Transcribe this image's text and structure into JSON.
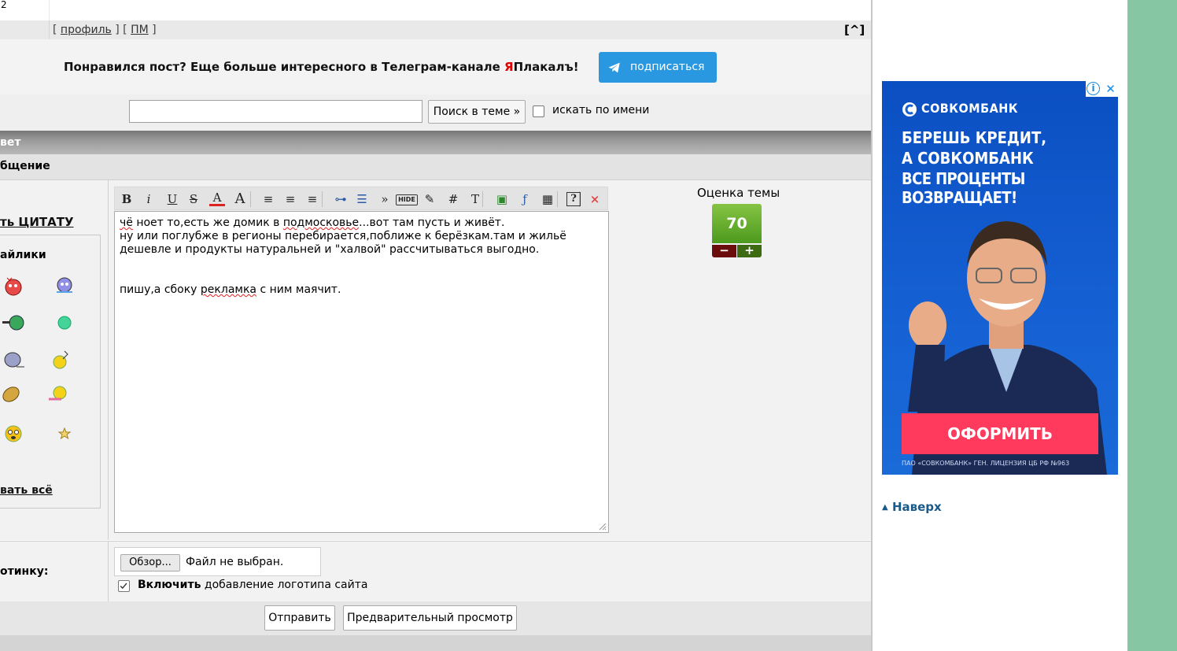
{
  "top_row": {
    "cell_text": "2"
  },
  "profile_row": {
    "open_bracket_1": "[",
    "profile_link": "профиль",
    "mid_brackets": "] [",
    "pm_link": "ПМ",
    "close_bracket": "]",
    "scroll_top_label": "[^]"
  },
  "promo": {
    "text_before": "Понравился пост? Еще больше интересного в Телеграм-канале ",
    "brand_red": "Я",
    "brand_rest": "Плакалъ!",
    "subscribe_label": "подписаться"
  },
  "search": {
    "input_value": "",
    "button_label": "Поиск в теме »",
    "checkbox_label": "искать по имени"
  },
  "reply_header": {
    "title": "вет"
  },
  "message_subheader": {
    "title": "бщение"
  },
  "left_panel": {
    "quote_link": "ть ЦИТАТУ",
    "smilies_title": "айлики",
    "show_all_link": "вать всё"
  },
  "editor": {
    "toolbar": [
      {
        "name": "bold",
        "glyph": "B"
      },
      {
        "name": "italic",
        "glyph": "i"
      },
      {
        "name": "underline",
        "glyph": "U"
      },
      {
        "name": "strikethrough",
        "glyph": "S"
      },
      {
        "name": "font-color",
        "glyph": "A"
      },
      {
        "name": "font-size",
        "glyph": "A"
      },
      {
        "name": "align-left",
        "glyph": "≡"
      },
      {
        "name": "align-center",
        "glyph": "≡"
      },
      {
        "name": "align-right",
        "glyph": "≡"
      },
      {
        "name": "link",
        "glyph": "⊶"
      },
      {
        "name": "list",
        "glyph": "☰"
      },
      {
        "name": "quote",
        "glyph": "»"
      },
      {
        "name": "hide",
        "glyph": "HIDE"
      },
      {
        "name": "edit",
        "glyph": "✎"
      },
      {
        "name": "hash",
        "glyph": "#"
      },
      {
        "name": "typeface",
        "glyph": "T"
      },
      {
        "name": "image",
        "glyph": "▣"
      },
      {
        "name": "flash",
        "glyph": "ƒ"
      },
      {
        "name": "video",
        "glyph": "▦"
      },
      {
        "name": "help",
        "glyph": "?"
      },
      {
        "name": "close",
        "glyph": "×"
      }
    ],
    "line1_a": "",
    "line1_w1": "чё",
    "line1_b": " ноет то,есть же домик в ",
    "line1_w2": "подмосковье",
    "line1_c": "...вот там пусть и живёт.",
    "line2": "ну или поглубже в регионы перебирается,поближе к берёзкам.там и жильё",
    "line3": "дешевле и продукты натуральней и \"халвой\" рассчитываться выгодно.",
    "line5_a": "пишу,а сбоку ",
    "line5_w": "рекламка",
    "line5_b": " с ним маячит."
  },
  "rating": {
    "label": "Оценка темы",
    "value": "70",
    "minus": "−",
    "plus": "+"
  },
  "upload": {
    "row_label": "отинку:",
    "browse_label": "Обзор...",
    "file_status": "Файл не выбран.",
    "logo_bold": "Включить",
    "logo_rest": " добавление логотипа сайта"
  },
  "submit": {
    "send_label": "Отправить",
    "preview_label": "Предварительный просмотр"
  },
  "ad": {
    "brand": "СОВКОМБАНК",
    "headline_1": "БЕРЕШЬ КРЕДИТ,",
    "headline_2": "А СОВКОМБАНК",
    "headline_3": "ВСЕ ПРОЦЕНТЫ ВОЗВРАЩАЕТ!",
    "cta": "ОФОРМИТЬ",
    "license": "ПАО «СОВКОМБАНК» ГЕН. ЛИЦЕНЗИЯ ЦБ РФ №963",
    "info_glyph": "i",
    "close_glyph": "✕"
  },
  "sidebar": {
    "to_top_arrow": "▲",
    "to_top_label": "Наверх"
  },
  "colors": {
    "telegram_blue": "#2a98e0",
    "brand_red": "#e00000",
    "rating_green": "#4c9a1e",
    "ad_blue": "#1561d4",
    "ad_cta": "#ff3a5c",
    "link_blue": "#1a5a8a"
  }
}
